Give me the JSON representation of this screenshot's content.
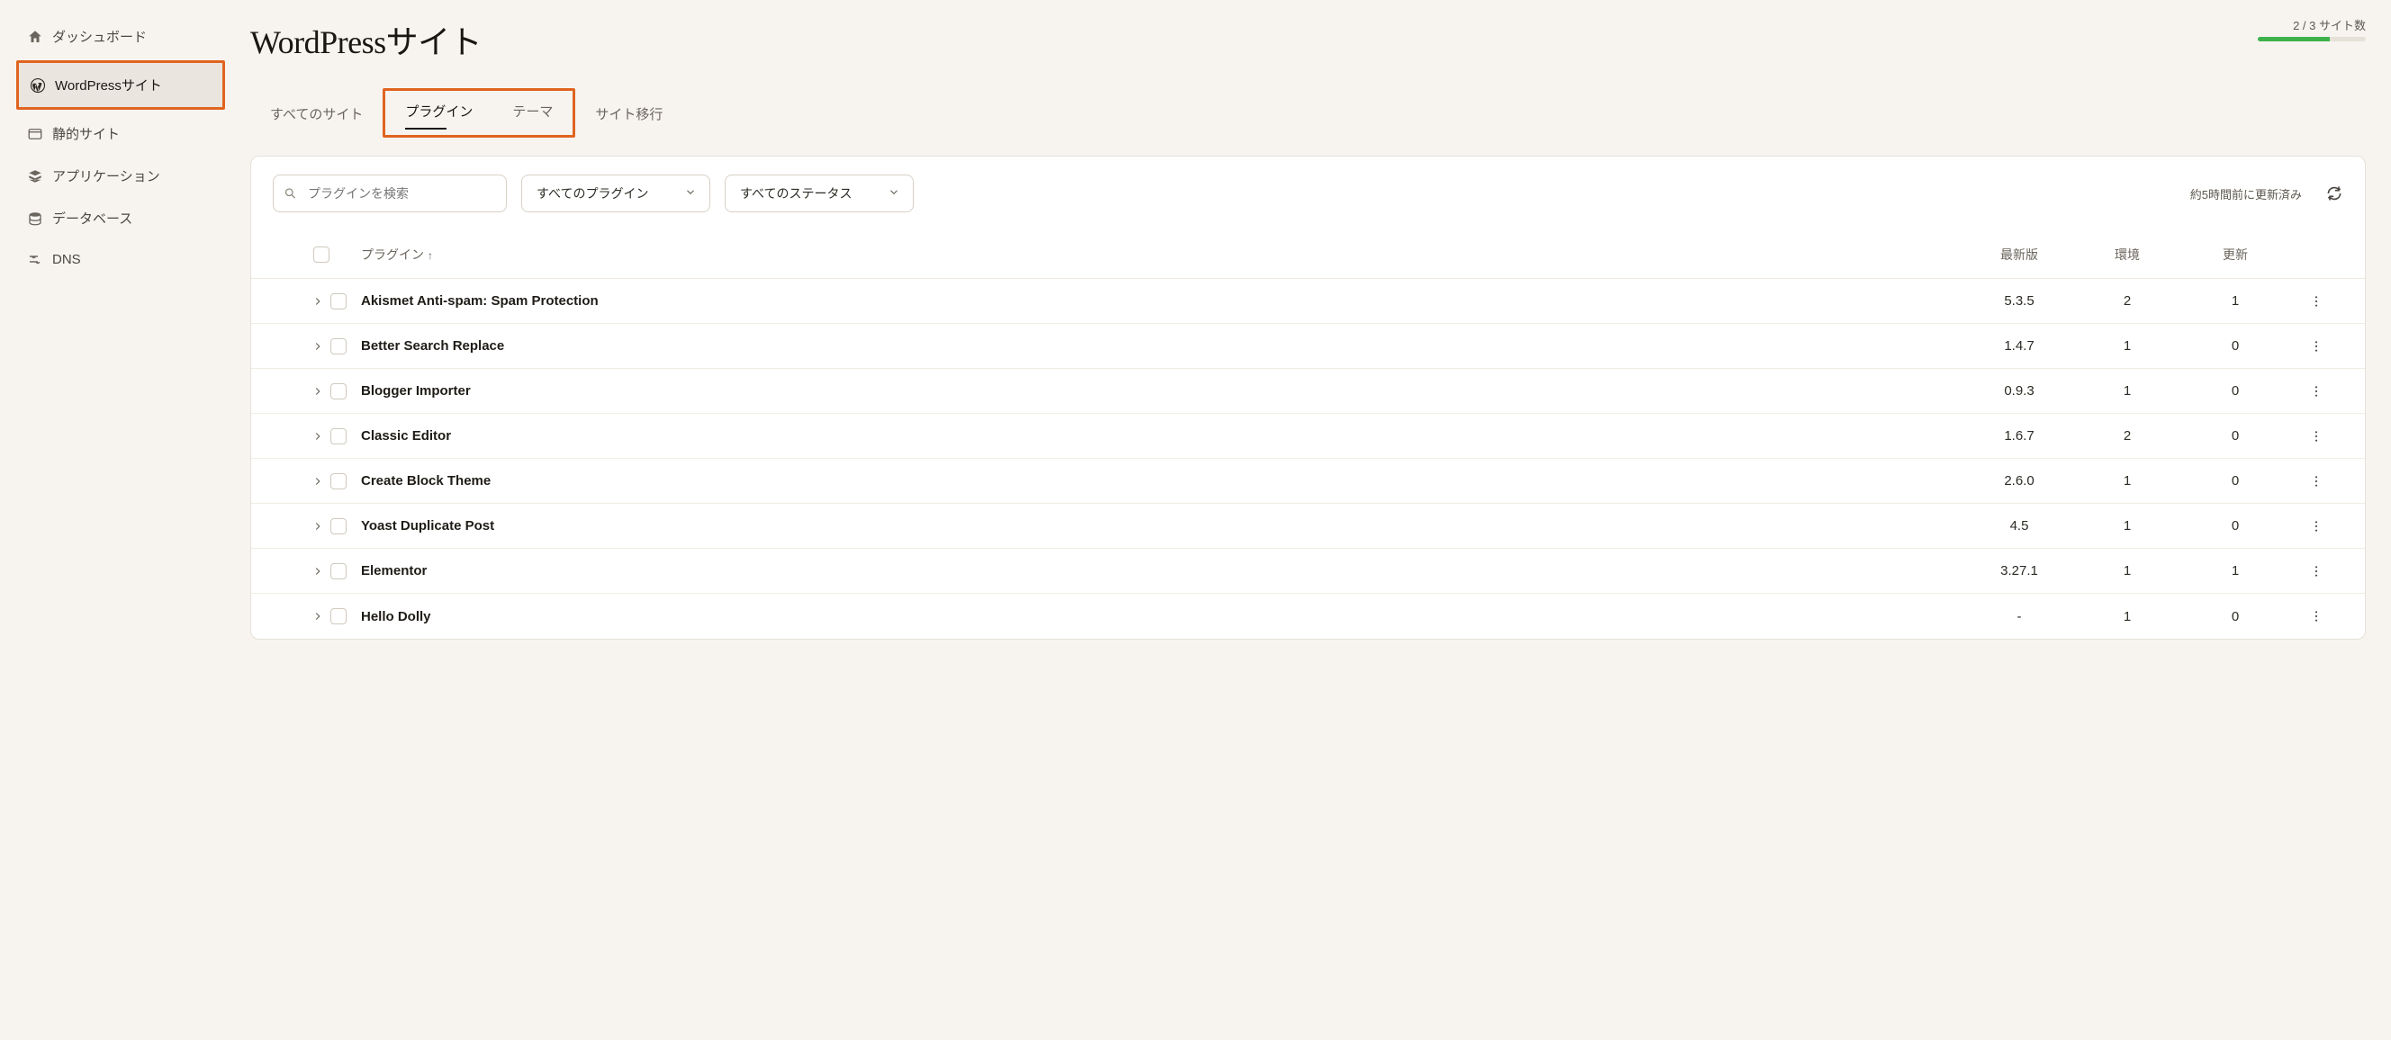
{
  "sidebar": {
    "items": [
      {
        "icon": "home",
        "label": "ダッシュボード"
      },
      {
        "icon": "wordpress",
        "label": "WordPressサイト"
      },
      {
        "icon": "static",
        "label": "静的サイト"
      },
      {
        "icon": "apps",
        "label": "アプリケーション"
      },
      {
        "icon": "database",
        "label": "データベース"
      },
      {
        "icon": "dns",
        "label": "DNS"
      }
    ]
  },
  "header": {
    "title": "WordPressサイト",
    "site_count_text": "2 / 3 サイト数"
  },
  "tabs": [
    {
      "label": "すべてのサイト"
    },
    {
      "label": "プラグイン"
    },
    {
      "label": "テーマ"
    },
    {
      "label": "サイト移行"
    }
  ],
  "toolbar": {
    "search_placeholder": "プラグインを検索",
    "filter_plugin": "すべてのプラグイン",
    "filter_status": "すべてのステータス",
    "refresh_text": "約5時間前に更新済み"
  },
  "table": {
    "columns": {
      "name": "プラグイン",
      "latest": "最新版",
      "env": "環境",
      "update": "更新"
    },
    "sort_indicator": "↑",
    "rows": [
      {
        "name": "Akismet Anti-spam: Spam Protection",
        "latest": "5.3.5",
        "env": "2",
        "update": "1"
      },
      {
        "name": "Better Search Replace",
        "latest": "1.4.7",
        "env": "1",
        "update": "0"
      },
      {
        "name": "Blogger Importer",
        "latest": "0.9.3",
        "env": "1",
        "update": "0"
      },
      {
        "name": "Classic Editor",
        "latest": "1.6.7",
        "env": "2",
        "update": "0"
      },
      {
        "name": "Create Block Theme",
        "latest": "2.6.0",
        "env": "1",
        "update": "0"
      },
      {
        "name": "Yoast Duplicate Post",
        "latest": "4.5",
        "env": "1",
        "update": "0"
      },
      {
        "name": "Elementor",
        "latest": "3.27.1",
        "env": "1",
        "update": "1"
      },
      {
        "name": "Hello Dolly",
        "latest": "-",
        "env": "1",
        "update": "0"
      }
    ]
  }
}
